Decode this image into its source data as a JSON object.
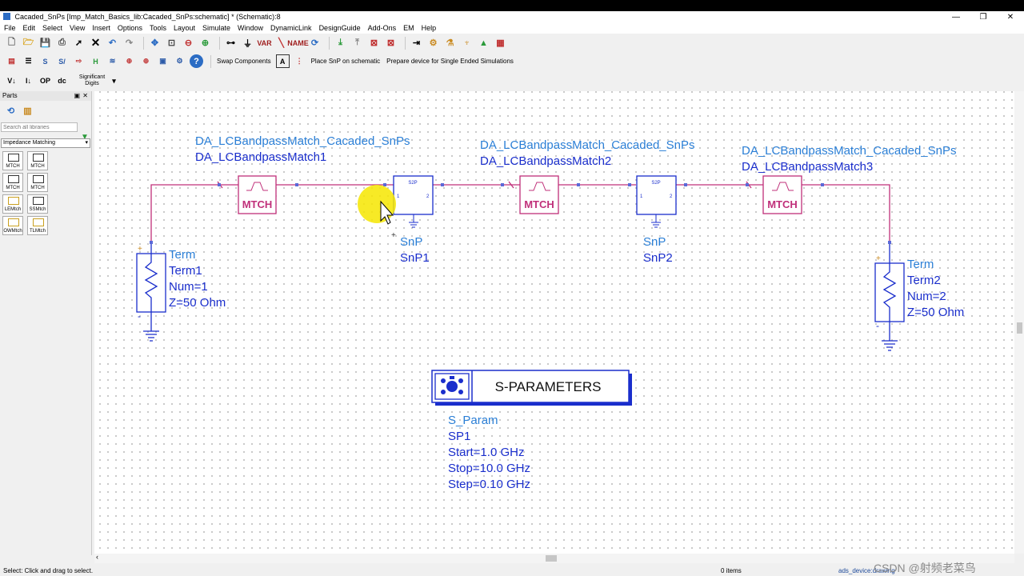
{
  "window": {
    "title": "Cacaded_SnPs [Imp_Match_Basics_lib:Cacaded_SnPs:schematic] * (Schematic):8",
    "min": "—",
    "restore": "❐",
    "close": "✕"
  },
  "menu": [
    "File",
    "Edit",
    "Select",
    "View",
    "Insert",
    "Options",
    "Tools",
    "Layout",
    "Simulate",
    "Window",
    "DynamicLink",
    "DesignGuide",
    "Add-Ons",
    "EM",
    "Help"
  ],
  "toolbar2": {
    "swap": "Swap Components",
    "place_snp": "Place SnP on schematic",
    "prepare": "Prepare device for Single Ended Simulations"
  },
  "toolbar3": {
    "significant_digits": "Significant Digits"
  },
  "parts": {
    "title": "Parts",
    "search_placeholder": "Search all libraries",
    "library": "Impedance Matching",
    "items": [
      "MTCH",
      "MTCH",
      "MTCH",
      "MTCH",
      "LEMtch",
      "SSMtch",
      "OWMtch",
      "TLMtch"
    ]
  },
  "schematic": {
    "blocks": [
      {
        "line1": "DA_LCBandpassMatch_Cacaded_SnPs",
        "line2": "DA_LCBandpassMatch1",
        "label": "MTCH"
      },
      {
        "line1": "DA_LCBandpassMatch_Cacaded_SnPs",
        "line2": "DA_LCBandpassMatch2",
        "label": "MTCH"
      },
      {
        "line1": "DA_LCBandpassMatch_Cacaded_SnPs",
        "line2": "DA_LCBandpassMatch3",
        "label": "MTCH"
      }
    ],
    "snps": [
      {
        "type": "SnP",
        "name": "SnP1",
        "label": "S2P",
        "p1": "1",
        "p2": "2"
      },
      {
        "type": "SnP",
        "name": "SnP2",
        "label": "S2P",
        "p1": "1",
        "p2": "2"
      }
    ],
    "terms": [
      {
        "type": "Term",
        "name": "Term1",
        "num": "Num=1",
        "z": "Z=50 Ohm"
      },
      {
        "type": "Term",
        "name": "Term2",
        "num": "Num=2",
        "z": "Z=50 Ohm"
      }
    ],
    "sparam": {
      "header": "S-PARAMETERS",
      "type": "S_Param",
      "name": "SP1",
      "start": "Start=1.0 GHz",
      "stop": "Stop=10.0 GHz",
      "step": "Step=0.10 GHz"
    }
  },
  "status": {
    "hint": "Select: Click and drag to select.",
    "items": "0 items",
    "context": "ads_device:drawing",
    "watermark": "CSDN @射频老菜鸟"
  },
  "colors": {
    "wire": "#c0307a",
    "component": "#1a2ecc",
    "label_blue": "#2b7fd6",
    "cursor_highlight": "#f6e600"
  }
}
